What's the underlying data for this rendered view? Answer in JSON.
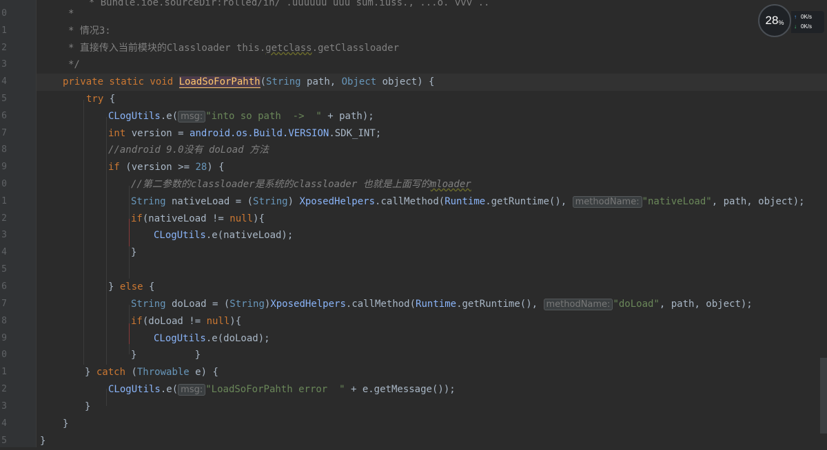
{
  "gutter": {
    "line_numbers": [
      "0",
      "1",
      "2",
      "3",
      "4",
      "5",
      "6",
      "7",
      "8",
      "9",
      "0",
      "1",
      "2",
      "3",
      "4",
      "5",
      "6",
      "7",
      "8",
      "9",
      "0",
      "1",
      "2",
      "3",
      "4",
      "5"
    ]
  },
  "code": {
    "l0_comment": "         * Bundle.ioe.sourceDir:rolled/in/ .uuuuuu uuu sum.iuss., ...o. vvv ..",
    "l1": "* ",
    "l2": "* 情况3:",
    "l3": "* 直接传入当前模块的Classloader this.",
    "l3_getclass": "getclass",
    "l3_rest": ".getClassloader",
    "l4": "*/",
    "method_sig_private": "private static void ",
    "method_name": "LoadSoForPahth",
    "method_params_open": "(",
    "param_type1": "String",
    "param_name1": " path, ",
    "param_type2": "Object",
    "param_name2": " object) {",
    "try_kw": "try",
    "try_brace": " {",
    "clog1_cls": "CLogUtils",
    "clog1_e": ".e(",
    "clog1_hint": "msg:",
    "clog1_str": "\"into so path  ->  \"",
    "clog1_rest": " + path);",
    "int_kw": "int",
    "int_rest": " version = ",
    "android_pkg": "android.os.Build.",
    "version_const": "VERSION",
    "sdk_int": ".SDK_INT;",
    "comment_android": "//android 9.0没有 doLoad 方法",
    "if_kw": "if",
    "if_rest1": " (version >= ",
    "if_num": "28",
    "if_rest2": ") {",
    "comment_second": "//第二参数的classloader是系统的classloader 也就是上面写的",
    "comment_second_mloader": "mloader",
    "native_type": "String",
    "native_rest1": " nativeLoad = (",
    "native_cast": "String",
    "native_rest2": ") ",
    "xposed1": "XposedHelpers",
    "native_call": ".callMethod(",
    "runtime1": "Runtime",
    "runtime_rest1": ".getRuntime(), ",
    "method_hint1": "methodName:",
    "native_str": "\"nativeLoad\"",
    "native_tail": ", path, object);",
    "if2_kw": "if",
    "if2_rest1": "(nativeLoad != ",
    "null1": "null",
    "if2_rest2": "){",
    "clog2_cls": "CLogUtils",
    "clog2_rest": ".e(nativeLoad);",
    "close_brace": "}",
    "else_open": "} ",
    "else_kw": "else",
    "else_brace": " {",
    "doload_type": "String",
    "doload_rest1": " doLoad = (",
    "doload_cast": "String",
    "doload_rest2": ")",
    "xposed2": "XposedHelpers",
    "doload_call": ".callMethod(",
    "runtime2": "Runtime",
    "runtime_rest2": ".getRuntime(), ",
    "method_hint2": "methodName:",
    "doload_str": "\"doLoad\"",
    "doload_tail": ", path, object);",
    "if3_kw": "if",
    "if3_rest1": "(doLoad != ",
    "null2": "null",
    "if3_rest2": "){",
    "clog3_cls": "CLogUtils",
    "clog3_rest": ".e(doLoad);",
    "double_close": "}          }",
    "catch_open": "} ",
    "catch_kw": "catch",
    "catch_rest1": " (",
    "throwable": "Throwable",
    "catch_rest2": " e) {",
    "clog4_cls": "CLogUtils",
    "clog4_e": ".e(",
    "clog4_hint": "msg:",
    "clog4_str": "\"LoadSoForPahth error  \"",
    "clog4_rest": " + e.getMessage());",
    "close1": "}",
    "close2": "}",
    "close3": "}"
  },
  "widget": {
    "percent": "28",
    "percent_sign": "%",
    "up_speed": "0K/s",
    "down_speed": "0K/s",
    "up_arrow": "↑",
    "down_arrow": "↓"
  },
  "colors": {
    "background": "#2b2b2b",
    "keyword": "#cc7832",
    "string": "#6a8759",
    "comment": "#808080",
    "method": "#ffc66d"
  }
}
